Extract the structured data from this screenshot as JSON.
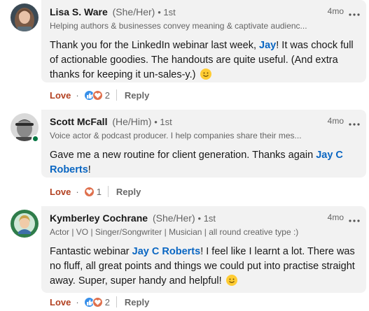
{
  "comments": [
    {
      "name": "Lisa S. Ware",
      "pronouns": "(She/Her)",
      "degree": "• 1st",
      "headline": "Helping authors & businesses convey meaning & captivate audienc...",
      "time": "4mo",
      "text_before": "Thank you for the LinkedIn webinar last week, ",
      "mention": "Jay",
      "text_after": "! It was chock full of actionable goodies. The handouts are quite useful. (And extra thanks for keeping it un-sales-y.) ",
      "love_label": "Love",
      "reaction_count": "2",
      "reply_label": "Reply",
      "online": false
    },
    {
      "name": "Scott McFall",
      "pronouns": "(He/Him)",
      "degree": "• 1st",
      "headline": "Voice actor & podcast producer. I help companies share their mes...",
      "time": "4mo",
      "text_before": "Gave me a new routine for client generation. Thanks again ",
      "mention": "Jay C Roberts",
      "text_after": "!",
      "love_label": "Love",
      "reaction_count": "1",
      "reply_label": "Reply",
      "online": true
    },
    {
      "name": "Kymberley Cochrane",
      "pronouns": "(She/Her)",
      "degree": "• 1st",
      "headline": "Actor | VO | Singer/Songwriter | Musician | all round creative type :)",
      "time": "4mo",
      "text_before": "Fantastic webinar ",
      "mention": "Jay C Roberts",
      "text_after": "! I feel like I learnt a lot. There was no fluff, all great points and things we could put into practise straight away. Super, super handy and helpful! ",
      "love_label": "Love",
      "reaction_count": "2",
      "reply_label": "Reply",
      "online": false
    }
  ],
  "colors": {
    "mention": "#0a66c2",
    "love": "#b24020",
    "bubble": "#f2f2f2",
    "online": "#057642"
  },
  "icons": [
    "more-options-icon",
    "like-reaction-icon",
    "love-reaction-icon",
    "smile-emoji-icon",
    "online-status-icon"
  ]
}
